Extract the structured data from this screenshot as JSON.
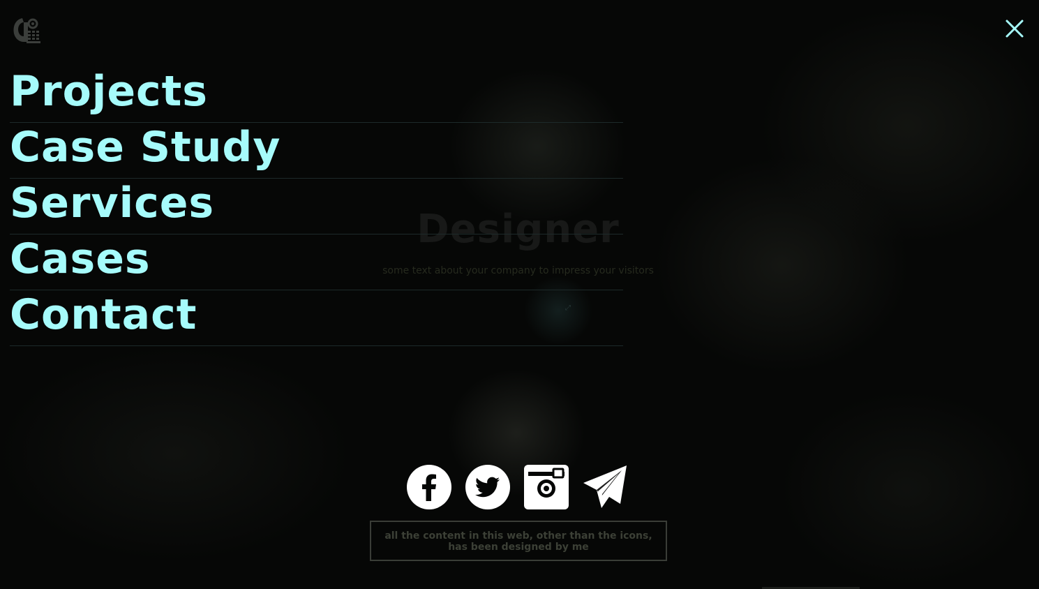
{
  "hero": {
    "title": "Designer",
    "subtitle": "some text about your company to impress your visitors"
  },
  "logo": {
    "icon": "camera-logo-icon"
  },
  "close": {
    "icon": "close-icon"
  },
  "menu": {
    "items": [
      {
        "label": "Projects"
      },
      {
        "label": "Case Study"
      },
      {
        "label": "Services"
      },
      {
        "label": "Cases"
      },
      {
        "label": "Contact"
      }
    ],
    "color": "#a6fbfb"
  },
  "social": {
    "items": [
      {
        "icon": "facebook-icon"
      },
      {
        "icon": "twitter-icon"
      },
      {
        "icon": "instagram-icon"
      },
      {
        "icon": "telegram-icon"
      }
    ]
  },
  "footer": {
    "credit": "all the content in this web, other than the icons, has been designed by me"
  }
}
